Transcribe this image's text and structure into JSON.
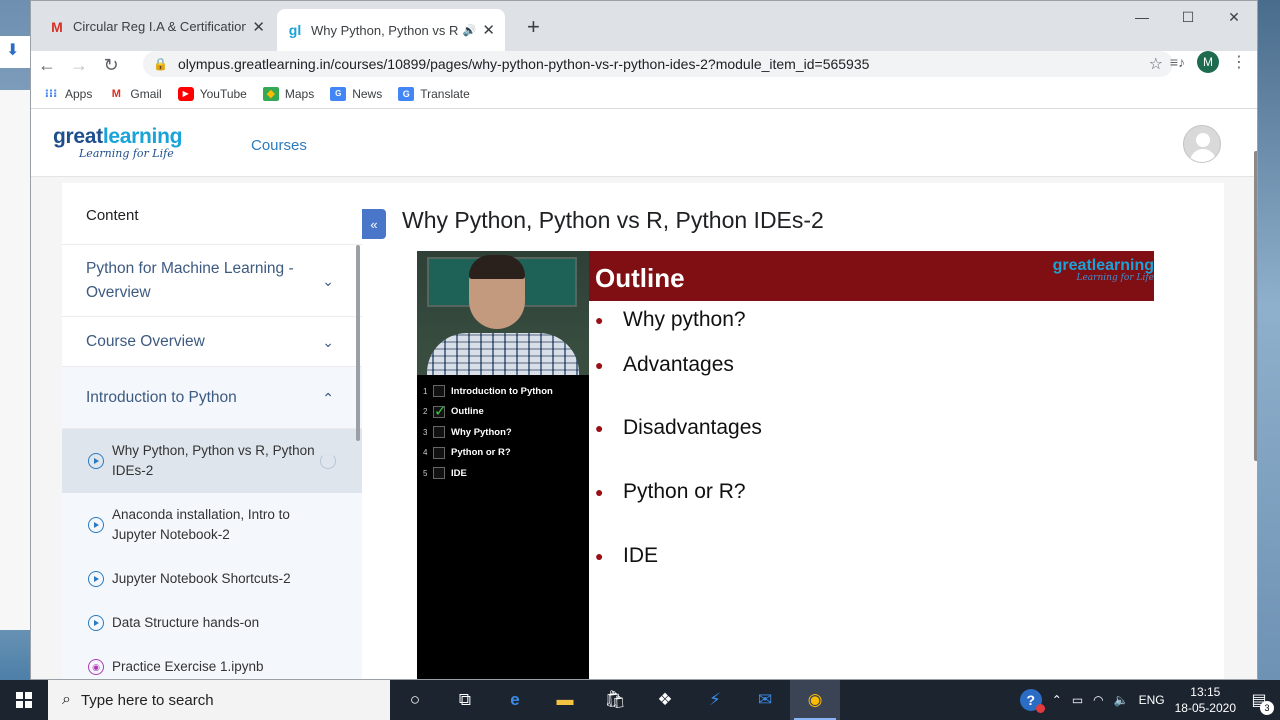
{
  "browser": {
    "tabs": [
      {
        "label": "Circular Reg I.A & Certifications/",
        "icon": "gmail-icon",
        "active": false
      },
      {
        "label": "Why Python, Python vs R, Py",
        "icon": "greatlearning-icon",
        "active": true
      }
    ],
    "new_tab_symbol": "+",
    "url": "olympus.greatlearning.in/courses/10899/pages/why-python-python-vs-r-python-ides-2?module_item_id=565935",
    "profile_initial": "M",
    "bookmarks": [
      {
        "label": "Apps",
        "icon": "apps-icon"
      },
      {
        "label": "Gmail",
        "icon": "gmail-icon"
      },
      {
        "label": "YouTube",
        "icon": "youtube-icon"
      },
      {
        "label": "Maps",
        "icon": "maps-icon"
      },
      {
        "label": "News",
        "icon": "news-icon"
      },
      {
        "label": "Translate",
        "icon": "translate-icon"
      }
    ]
  },
  "site": {
    "logo_main": "great",
    "logo_accent": "learning",
    "logo_tagline": "Learning for Life",
    "nav_courses": "Courses"
  },
  "sidebar": {
    "title": "Content",
    "modules": [
      {
        "label": "Python for Machine Learning - Overview",
        "expanded": false
      },
      {
        "label": "Course Overview",
        "expanded": false
      },
      {
        "label": "Introduction to Python",
        "expanded": true
      }
    ],
    "lessons": [
      {
        "label": "Why Python, Python vs R, Python IDEs-2",
        "type": "video",
        "active": true
      },
      {
        "label": "Anaconda installation, Intro to Jupyter Notebook-2",
        "type": "video",
        "active": false
      },
      {
        "label": "Jupyter Notebook Shortcuts-2",
        "type": "video",
        "active": false
      },
      {
        "label": "Data Structure hands-on",
        "type": "video",
        "active": false
      },
      {
        "label": "Practice Exercise 1.ipynb",
        "type": "notebook",
        "active": false
      }
    ]
  },
  "main": {
    "collapse_symbol": "«",
    "lesson_title": "Why Python, Python vs R, Python IDEs-2"
  },
  "video": {
    "toc": [
      {
        "n": "1",
        "label": "Introduction to Python",
        "checked": false
      },
      {
        "n": "2",
        "label": "Outline",
        "checked": true
      },
      {
        "n": "3",
        "label": "Why Python?",
        "checked": false
      },
      {
        "n": "4",
        "label": "Python or R?",
        "checked": false
      },
      {
        "n": "5",
        "label": "IDE",
        "checked": false
      }
    ],
    "slide_title": "Outline",
    "slide_logo_main": "greatlearning",
    "slide_logo_tagline": "Learning for Life",
    "bullets": [
      "Why python?",
      "Advantages",
      "Disadvantages",
      "Python or R?",
      "IDE"
    ]
  },
  "taskbar": {
    "search_placeholder": "Type here to search",
    "language": "ENG",
    "time": "13:15",
    "date": "18-05-2020",
    "notification_count": "3"
  }
}
